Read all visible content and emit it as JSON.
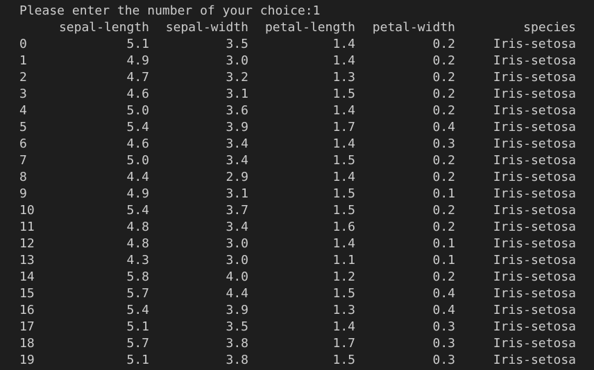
{
  "terminal": {
    "prompt": "Please enter the number of your choice:1",
    "headers": [
      "sepal-length",
      "sepal-width",
      "petal-length",
      "petal-width",
      "species"
    ],
    "rows": [
      {
        "index": "0",
        "sepal_length": "5.1",
        "sepal_width": "3.5",
        "petal_length": "1.4",
        "petal_width": "0.2",
        "species": "Iris-setosa"
      },
      {
        "index": "1",
        "sepal_length": "4.9",
        "sepal_width": "3.0",
        "petal_length": "1.4",
        "petal_width": "0.2",
        "species": "Iris-setosa"
      },
      {
        "index": "2",
        "sepal_length": "4.7",
        "sepal_width": "3.2",
        "petal_length": "1.3",
        "petal_width": "0.2",
        "species": "Iris-setosa"
      },
      {
        "index": "3",
        "sepal_length": "4.6",
        "sepal_width": "3.1",
        "petal_length": "1.5",
        "petal_width": "0.2",
        "species": "Iris-setosa"
      },
      {
        "index": "4",
        "sepal_length": "5.0",
        "sepal_width": "3.6",
        "petal_length": "1.4",
        "petal_width": "0.2",
        "species": "Iris-setosa"
      },
      {
        "index": "5",
        "sepal_length": "5.4",
        "sepal_width": "3.9",
        "petal_length": "1.7",
        "petal_width": "0.4",
        "species": "Iris-setosa"
      },
      {
        "index": "6",
        "sepal_length": "4.6",
        "sepal_width": "3.4",
        "petal_length": "1.4",
        "petal_width": "0.3",
        "species": "Iris-setosa"
      },
      {
        "index": "7",
        "sepal_length": "5.0",
        "sepal_width": "3.4",
        "petal_length": "1.5",
        "petal_width": "0.2",
        "species": "Iris-setosa"
      },
      {
        "index": "8",
        "sepal_length": "4.4",
        "sepal_width": "2.9",
        "petal_length": "1.4",
        "petal_width": "0.2",
        "species": "Iris-setosa"
      },
      {
        "index": "9",
        "sepal_length": "4.9",
        "sepal_width": "3.1",
        "petal_length": "1.5",
        "petal_width": "0.1",
        "species": "Iris-setosa"
      },
      {
        "index": "10",
        "sepal_length": "5.4",
        "sepal_width": "3.7",
        "petal_length": "1.5",
        "petal_width": "0.2",
        "species": "Iris-setosa"
      },
      {
        "index": "11",
        "sepal_length": "4.8",
        "sepal_width": "3.4",
        "petal_length": "1.6",
        "petal_width": "0.2",
        "species": "Iris-setosa"
      },
      {
        "index": "12",
        "sepal_length": "4.8",
        "sepal_width": "3.0",
        "petal_length": "1.4",
        "petal_width": "0.1",
        "species": "Iris-setosa"
      },
      {
        "index": "13",
        "sepal_length": "4.3",
        "sepal_width": "3.0",
        "petal_length": "1.1",
        "petal_width": "0.1",
        "species": "Iris-setosa"
      },
      {
        "index": "14",
        "sepal_length": "5.8",
        "sepal_width": "4.0",
        "petal_length": "1.2",
        "petal_width": "0.2",
        "species": "Iris-setosa"
      },
      {
        "index": "15",
        "sepal_length": "5.7",
        "sepal_width": "4.4",
        "petal_length": "1.5",
        "petal_width": "0.4",
        "species": "Iris-setosa"
      },
      {
        "index": "16",
        "sepal_length": "5.4",
        "sepal_width": "3.9",
        "petal_length": "1.3",
        "petal_width": "0.4",
        "species": "Iris-setosa"
      },
      {
        "index": "17",
        "sepal_length": "5.1",
        "sepal_width": "3.5",
        "petal_length": "1.4",
        "petal_width": "0.3",
        "species": "Iris-setosa"
      },
      {
        "index": "18",
        "sepal_length": "5.7",
        "sepal_width": "3.8",
        "petal_length": "1.7",
        "petal_width": "0.3",
        "species": "Iris-setosa"
      },
      {
        "index": "19",
        "sepal_length": "5.1",
        "sepal_width": "3.8",
        "petal_length": "1.5",
        "petal_width": "0.3",
        "species": "Iris-setosa"
      }
    ]
  }
}
